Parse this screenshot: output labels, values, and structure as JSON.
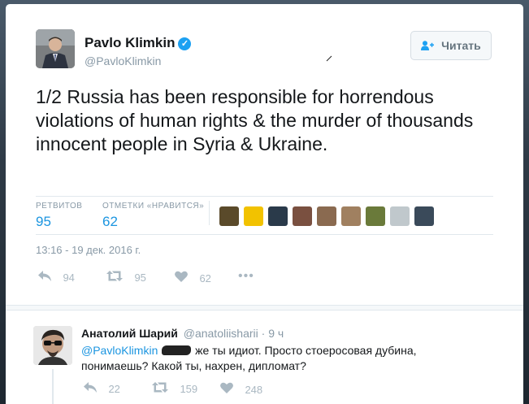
{
  "tweet": {
    "author_name": "Pavlo Klimkin",
    "verified_glyph": "✓",
    "handle": "@PavloKlimkin",
    "follow_label": "Читать",
    "follow_icon": "add-user-icon",
    "text": "1/2 Russia has been responsible for horrendous violations of human rights & the murder of thousands innocent people in Syria & Ukraine.",
    "stats": {
      "retweets_label": "РЕТВИТОВ",
      "retweets": "95",
      "likes_label": "ОТМЕТКИ «НРАВИТСЯ»",
      "likes": "62"
    },
    "liker_colors": [
      "#5a4a2a",
      "#f2c200",
      "#2a3a4a",
      "#7a5040",
      "#8a6a50",
      "#a08060",
      "#6a7a3a",
      "#c0c8cc",
      "#3a4a5a"
    ],
    "timestamp": "13:16 - 19 дек. 2016 г.",
    "actions": {
      "reply_count": "94",
      "retweet_count": "95",
      "like_count": "62",
      "more": "•••"
    }
  },
  "reply": {
    "author_name": "Анатолий Шарий",
    "handle": "@anatoliisharii",
    "time": "· 9 ч",
    "mention": "@PavloKlimkin",
    "text_after_redaction": "же ты идиот. Просто стоеросовая дубина, понимаешь? Какой ты, нахрен, дипломат?",
    "actions": {
      "reply_count": "22",
      "retweet_count": "159",
      "like_count": "248"
    }
  },
  "colors": {
    "link": "#1b95e0",
    "verified": "#1da1f2",
    "muted": "#8899a6"
  }
}
